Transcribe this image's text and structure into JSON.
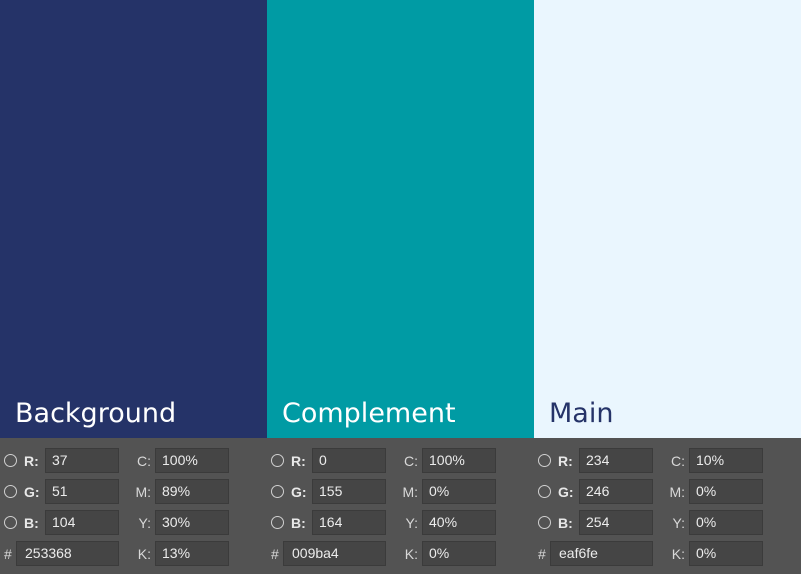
{
  "swatches": [
    {
      "label": "Background",
      "color": "#253368",
      "text_color": "#ffffff",
      "r": "37",
      "g": "51",
      "b": "104",
      "c": "100%",
      "m": "89%",
      "y": "30%",
      "k": "13%",
      "hex": "253368"
    },
    {
      "label": "Complement",
      "color": "#009ba4",
      "text_color": "#ffffff",
      "r": "0",
      "g": "155",
      "b": "164",
      "c": "100%",
      "m": "0%",
      "y": "40%",
      "k": "0%",
      "hex": "009ba4"
    },
    {
      "label": "Main",
      "color": "#eaf6fe",
      "text_color": "#253368",
      "r": "234",
      "g": "246",
      "b": "254",
      "c": "10%",
      "m": "0%",
      "y": "0%",
      "k": "0%",
      "hex": "eaf6fe"
    }
  ],
  "labels": {
    "r": "R:",
    "g": "G:",
    "b": "B:",
    "c": "C:",
    "m": "M:",
    "y": "Y:",
    "k": "K:",
    "hash": "#"
  }
}
